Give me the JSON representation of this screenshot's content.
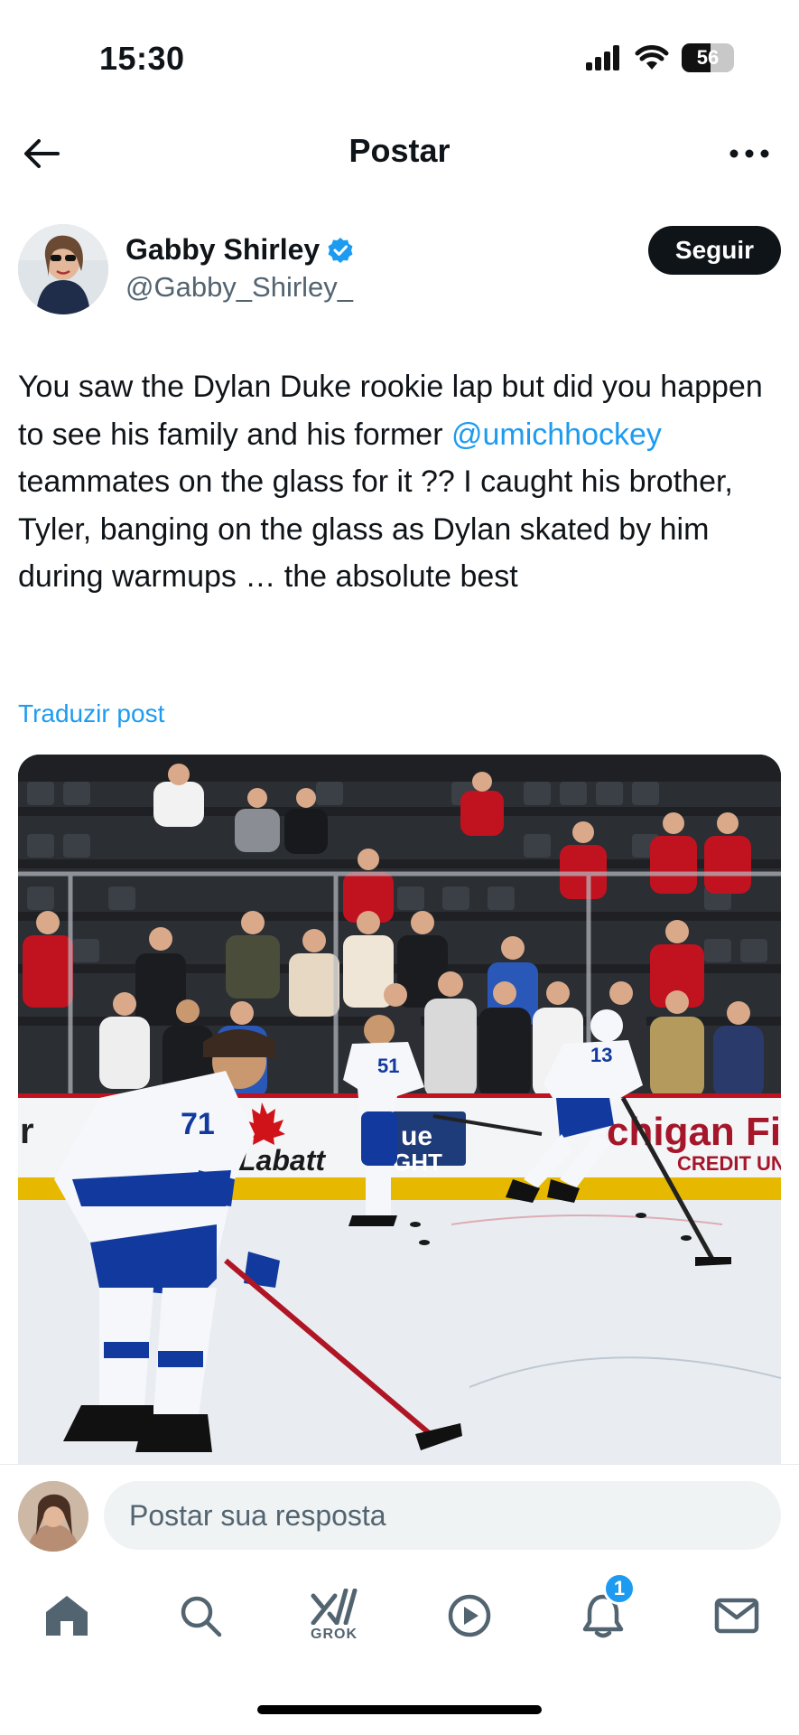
{
  "status_bar": {
    "time": "15:30",
    "battery": "56",
    "battery_level": 0.56,
    "icons": [
      "signal-icon",
      "wifi-icon",
      "battery-icon"
    ]
  },
  "header": {
    "title": "Postar",
    "back_icon": "arrow-left-icon",
    "more_icon": "more-horizontal-icon"
  },
  "author": {
    "name": "Gabby Shirley",
    "handle": "@Gabby_Shirley_",
    "verified": true,
    "follow_label": "Seguir"
  },
  "post": {
    "text_1": "You saw the Dylan Duke rookie lap but did you happen to see his family and his former ",
    "mention": "@umichhockey",
    "text_2": " teammates on the glass for it ?? I caught his brother, Tyler, banging on the glass as Dylan skated by him during warmups … the absolute best",
    "translate_label": "Traduzir post"
  },
  "media": {
    "boards_left": "r",
    "boards_labatt": "Labatt",
    "boards_blue_1": "ue",
    "boards_blue_2": "GHT",
    "boards_right_1": "chigan Firs",
    "boards_right_2": "CREDIT UNI",
    "jersey_1": "71",
    "jersey_2": "51",
    "jersey_3": "13"
  },
  "reply": {
    "placeholder": "Postar sua resposta"
  },
  "tab_bar": {
    "items": [
      {
        "icon": "home-icon"
      },
      {
        "icon": "search-icon"
      },
      {
        "icon": "grok-icon",
        "label": "GROK"
      },
      {
        "icon": "play-circle-icon"
      },
      {
        "icon": "bell-icon",
        "badge": "1"
      },
      {
        "icon": "mail-icon"
      }
    ]
  },
  "colors": {
    "accent": "#1d9bf0",
    "text": "#0f1419",
    "secondary": "#536471",
    "follow_bg": "#0f1419"
  }
}
